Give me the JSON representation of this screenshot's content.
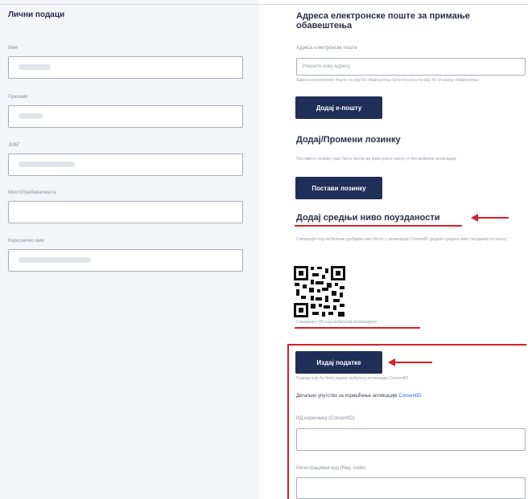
{
  "left": {
    "title": "Лични подаци",
    "fields": [
      {
        "label": "Име"
      },
      {
        "label": "Презиме"
      },
      {
        "label": "ЈМБГ"
      },
      {
        "label": "МестоПребивалишта"
      },
      {
        "label": "Корисничко име"
      }
    ]
  },
  "right": {
    "email_title": "Адреса електронске поште за примање обавештења",
    "email_label": "Адреса електронске поште",
    "email_placeholder": "Упишите нову адресу",
    "email_hint": "Адреса електронске поште на коју ће обавештења бити послата на коју ће се шаљу обавештења",
    "add_email_button": "Додај е-пошту",
    "password_title": "Додај/Промени лозинку",
    "password_hint": "Поставите лозинку како бисте могли да приступате налогу и без мобилне апликације",
    "set_password_button": "Постави лозинку",
    "mid_level_title": "Додај средњи ниво поузданости",
    "mid_level_hint": "Скенирајте код мобилним уређајем како бисте у апликацији ConsentID додали средњи ниво поузданости налогу",
    "qr_caption": "Скенирајте QR код мобилном апликацијом",
    "issue_button": "Издај податке",
    "issue_hint": "Подаци који ће бити издати мобилној апликацији ConsentID",
    "instructions_text": "Детаљно упутство за коришћење апликације ",
    "instructions_link": "ConsentID",
    "consent_id_label": "ИД корисника (ConsentID)",
    "reg_code_label": "Регистрациони код (Reg. code)"
  },
  "colors": {
    "accent": "#1f2f57",
    "highlight": "#d4202a"
  }
}
